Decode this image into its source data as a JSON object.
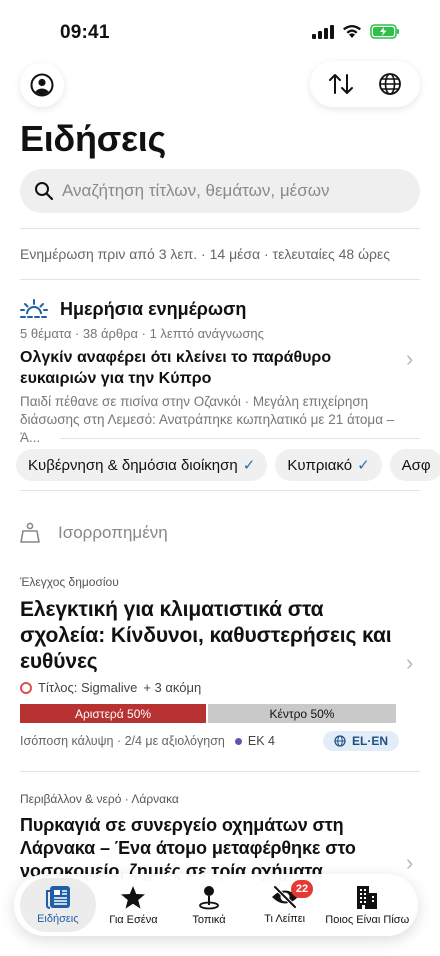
{
  "status": {
    "time": "09:41"
  },
  "header": {
    "title": "Ειδήσεις"
  },
  "search": {
    "placeholder": "Αναζήτηση τίτλων, θεμάτων, μέσων"
  },
  "update_line": "Ενημέρωση πριν από 3 λεπ. · 14 μέσα · τελευταίες 48 ώρες",
  "briefing": {
    "title": "Ημερήσια ενημέρωση",
    "meta": "5 θέματα · 38 άρθρα · 1 λεπτό ανάγνωσης",
    "headline": "Ολγκίν αναφέρει ότι κλείνει το παράθυρο ευκαιριών για την Κύπρο",
    "subtext": "Παιδί πέθανε σε πισίνα στην Οζανκόι · Μεγάλη επιχείρηση διάσωσης στη Λεμεσό: Ανατράπηκε κωπηλατικό με 21 άτομα – Ά..."
  },
  "chips": [
    {
      "label": "Κυβέρνηση & δημόσια διοίκηση",
      "check": "✓"
    },
    {
      "label": "Κυπριακό",
      "check": "✓"
    },
    {
      "label": "Ασφ",
      "check": ""
    }
  ],
  "section": {
    "label": "Ισορροπημένη"
  },
  "story1": {
    "category": "Έλεγχος δημοσίου",
    "title": "Ελεγκτική για κλιματιστικά στα σχολεία: Κίνδυνοι, καθυστερήσεις και ευθύνες",
    "source": "Τίτλος: Sigmalive",
    "more": "+ 3 ακόμη",
    "bias": {
      "left_label": "Αριστερά 50%",
      "center_label": "Κέντρο 50%",
      "left_fraction": 0.5,
      "center_fraction": 0.5
    },
    "coverage": "Ισόποση κάλυψη · 2/4 με αξιολόγηση",
    "ek": "ΕΚ 4",
    "lang": "EL·EN"
  },
  "story2": {
    "category": "Περιβάλλον & νερό · Λάρνακα",
    "title": "Πυρκαγιά σε συνεργείο οχημάτων στη Λάρνακα – Ένα άτομο μεταφέρθηκε στο νοσοκομείο, ζημιές σε τρία οχήματα"
  },
  "tabs": [
    {
      "label": "Ειδήσεις",
      "icon": "newspaper-icon",
      "active": true
    },
    {
      "label": "Για Εσένα",
      "icon": "star-icon"
    },
    {
      "label": "Τοπικά",
      "icon": "map-pin-icon"
    },
    {
      "label": "Τι Λείπει",
      "icon": "eye-slash-icon",
      "badge": "22"
    },
    {
      "label": "Ποιος Είναι Πίσω",
      "icon": "building-icon"
    }
  ],
  "colors": {
    "accent": "#1f5fa8",
    "bias_left": "#b83232",
    "bias_center": "#c9c9c9",
    "badge": "#e53935"
  }
}
